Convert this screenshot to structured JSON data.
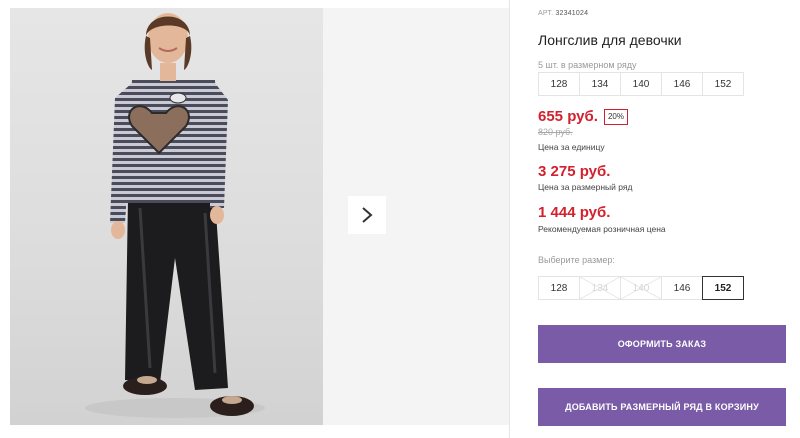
{
  "product": {
    "art_label": "АРТ.",
    "art_number": "32341024",
    "title": "Лонгслив для девочки"
  },
  "size_series": {
    "hint": "5 шт. в размерном ряду",
    "sizes": [
      "128",
      "134",
      "140",
      "146",
      "152"
    ]
  },
  "prices": {
    "unit_price": "655 руб.",
    "discount": "20%",
    "old_price": "820 руб.",
    "unit_caption": "Цена за единицу",
    "series_price": "3 275 руб.",
    "series_caption": "Цена за размерный ряд",
    "retail_price": "1 444 руб.",
    "retail_caption": "Рекомендуемая розничная цена"
  },
  "size_select": {
    "hint": "Выберите размер:",
    "options": [
      {
        "label": "128",
        "state": "available"
      },
      {
        "label": "134",
        "state": "disabled"
      },
      {
        "label": "140",
        "state": "disabled"
      },
      {
        "label": "146",
        "state": "available"
      },
      {
        "label": "152",
        "state": "selected"
      }
    ]
  },
  "actions": {
    "order_label": "ОФОРМИТЬ ЗАКАЗ",
    "add_series_label": "ДОБАВИТЬ РАЗМЕРНЫЙ РЯД В КОРЗИНУ"
  },
  "colors": {
    "accent": "#7a5ba7",
    "price_red": "#d3202e"
  },
  "icons": {
    "next": "chevron-right-icon"
  }
}
